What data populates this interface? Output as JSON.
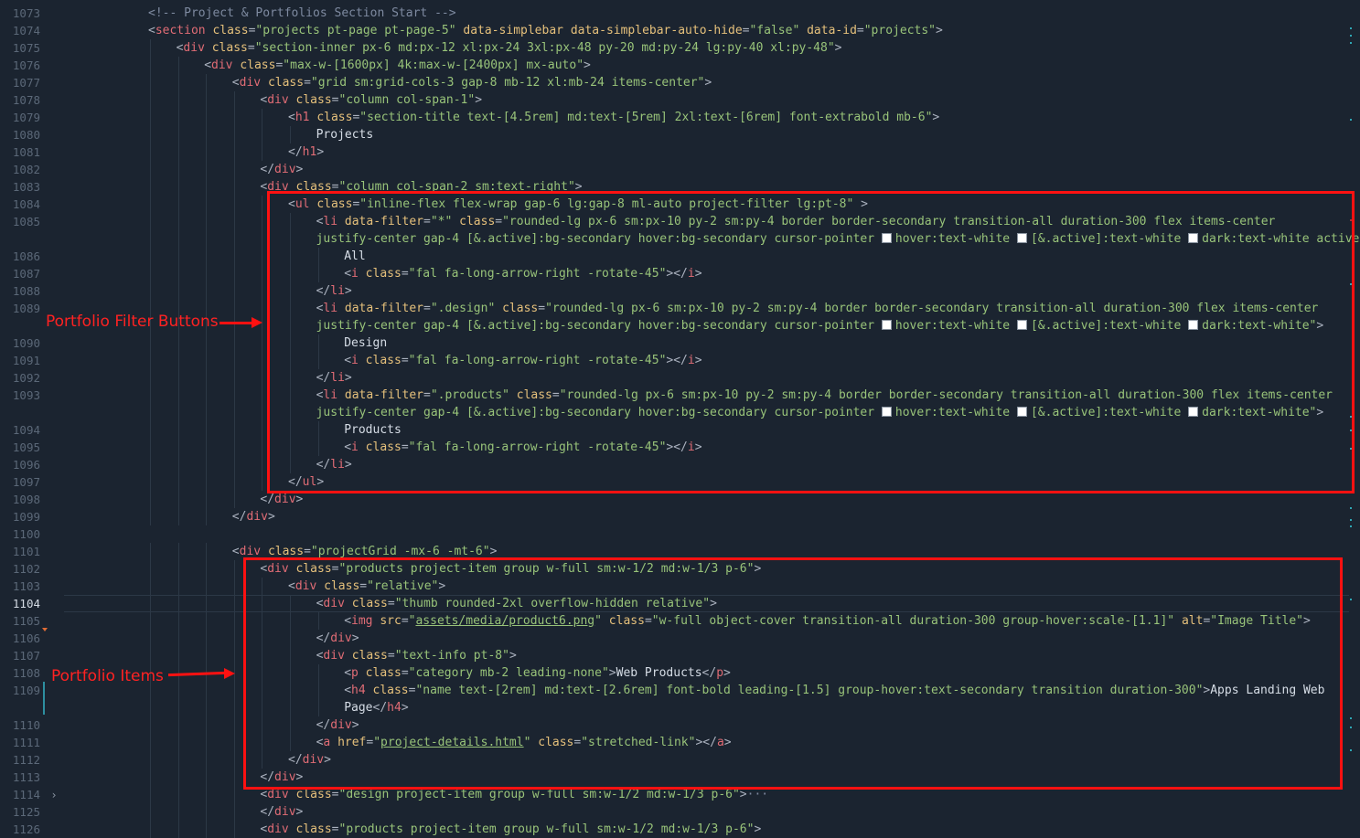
{
  "editor": {
    "current_line": "1104",
    "lines": [
      {
        "no": "1073",
        "indent": 0,
        "html": "<span class=\"comment\">&lt;!-- Project &amp; Portfolios Section Start --&gt;</span>"
      },
      {
        "no": "1074",
        "indent": 0,
        "html": "<span class=\"punct\">&lt;</span><span class=\"tag\">section</span> <span class=\"attr\">class</span><span class=\"punct\">=</span><span class=\"val\">\"projects pt-page pt-page-5\"</span> <span class=\"attr\">data-simplebar</span> <span class=\"attr\">data-simplebar-auto-hide</span><span class=\"punct\">=</span><span class=\"val\">\"false\"</span> <span class=\"attr\">data-id</span><span class=\"punct\">=</span><span class=\"val\">\"projects\"</span><span class=\"punct\">&gt;</span>"
      },
      {
        "no": "1075",
        "indent": 1,
        "html": "<span class=\"punct\">&lt;</span><span class=\"tag\">div</span> <span class=\"attr\">class</span><span class=\"punct\">=</span><span class=\"val\">\"section-inner px-6 md:px-12 xl:px-24 3xl:px-48 py-20 md:py-24 lg:py-40 xl:py-48\"</span><span class=\"punct\">&gt;</span>"
      },
      {
        "no": "1076",
        "indent": 2,
        "html": "<span class=\"punct\">&lt;</span><span class=\"tag\">div</span> <span class=\"attr\">class</span><span class=\"punct\">=</span><span class=\"val\">\"max-w-[1600px] 4k:max-w-[2400px] mx-auto\"</span><span class=\"punct\">&gt;</span>"
      },
      {
        "no": "1077",
        "indent": 3,
        "html": "<span class=\"punct\">&lt;</span><span class=\"tag\">div</span> <span class=\"attr\">class</span><span class=\"punct\">=</span><span class=\"val\">\"grid sm:grid-cols-3 gap-8 mb-12 xl:mb-24 items-center\"</span><span class=\"punct\">&gt;</span>"
      },
      {
        "no": "1078",
        "indent": 4,
        "html": "<span class=\"punct\">&lt;</span><span class=\"tag\">div</span> <span class=\"attr\">class</span><span class=\"punct\">=</span><span class=\"val\">\"column col-span-1\"</span><span class=\"punct\">&gt;</span>"
      },
      {
        "no": "1079",
        "indent": 5,
        "html": "<span class=\"punct\">&lt;</span><span class=\"tag\">h1</span> <span class=\"attr\">class</span><span class=\"punct\">=</span><span class=\"val\">\"section-title text-[4.5rem] md:text-[5rem] 2xl:text-[6rem] font-extrabold mb-6\"</span><span class=\"punct\">&gt;</span>"
      },
      {
        "no": "1080",
        "indent": 6,
        "html": "<span class=\"txt\">Projects</span>"
      },
      {
        "no": "1081",
        "indent": 5,
        "html": "<span class=\"punct\">&lt;/</span><span class=\"tag\">h1</span><span class=\"punct\">&gt;</span>"
      },
      {
        "no": "1082",
        "indent": 4,
        "html": "<span class=\"punct\">&lt;/</span><span class=\"tag\">div</span><span class=\"punct\">&gt;</span>"
      },
      {
        "no": "1083",
        "indent": 4,
        "html": "<span class=\"punct\">&lt;</span><span class=\"tag\">div</span> <span class=\"attr\">class</span><span class=\"punct\">=</span><span class=\"val\">\"column col-span-2 sm:text-right\"</span><span class=\"punct\">&gt;</span>"
      },
      {
        "no": "1084",
        "indent": 5,
        "html": "<span class=\"punct\">&lt;</span><span class=\"tag\">ul</span> <span class=\"attr\">class</span><span class=\"punct\">=</span><span class=\"val\">\"inline-flex flex-wrap gap-6 lg:gap-8 ml-auto project-filter lg:pt-8\"</span> <span class=\"punct\">&gt;</span>"
      },
      {
        "no": "1085",
        "indent": 6,
        "html": "<span class=\"punct\">&lt;</span><span class=\"tag\">li</span> <span class=\"attr\">data-filter</span><span class=\"punct\">=</span><span class=\"val\">\"*\"</span> <span class=\"attr\">class</span><span class=\"punct\">=</span><span class=\"val\">\"rounded-lg px-6 sm:px-10 py-2 sm:py-4 border border-secondary transition-all duration-300 flex items-center</span>"
      },
      {
        "no": "",
        "indent": 6,
        "html": "<span class=\"val\">justify-center gap-4 [&amp;.active]:bg-secondary hover:bg-secondary cursor-pointer <span class=\"swatch\"></span>hover:text-white <span class=\"swatch\"></span>[&amp;.active]:text-white <span class=\"swatch\"></span>dark:text-white active</span>"
      },
      {
        "no": "1086",
        "indent": 7,
        "html": "<span class=\"txt\">All</span>"
      },
      {
        "no": "1087",
        "indent": 7,
        "html": "<span class=\"punct\">&lt;</span><span class=\"tag\">i</span> <span class=\"attr\">class</span><span class=\"punct\">=</span><span class=\"val\">\"fal fa-long-arrow-right -rotate-45\"</span><span class=\"punct\">&gt;&lt;/</span><span class=\"tag\">i</span><span class=\"punct\">&gt;</span>"
      },
      {
        "no": "1088",
        "indent": 6,
        "html": "<span class=\"punct\">&lt;/</span><span class=\"tag\">li</span><span class=\"punct\">&gt;</span>"
      },
      {
        "no": "1089",
        "indent": 6,
        "html": "<span class=\"punct\">&lt;</span><span class=\"tag\">li</span> <span class=\"attr\">data-filter</span><span class=\"punct\">=</span><span class=\"val\">\".design\"</span> <span class=\"attr\">class</span><span class=\"punct\">=</span><span class=\"val\">\"rounded-lg px-6 sm:px-10 py-2 sm:py-4 border border-secondary transition-all duration-300 flex items-center</span>"
      },
      {
        "no": "",
        "indent": 6,
        "html": "<span class=\"val\">justify-center gap-4 [&amp;.active]:bg-secondary hover:bg-secondary cursor-pointer <span class=\"swatch\"></span>hover:text-white <span class=\"swatch\"></span>[&amp;.active]:text-white <span class=\"swatch\"></span>dark:text-white\"</span><span class=\"punct\">&gt;</span>"
      },
      {
        "no": "1090",
        "indent": 7,
        "html": "<span class=\"txt\">Design</span>"
      },
      {
        "no": "1091",
        "indent": 7,
        "html": "<span class=\"punct\">&lt;</span><span class=\"tag\">i</span> <span class=\"attr\">class</span><span class=\"punct\">=</span><span class=\"val\">\"fal fa-long-arrow-right -rotate-45\"</span><span class=\"punct\">&gt;&lt;/</span><span class=\"tag\">i</span><span class=\"punct\">&gt;</span>"
      },
      {
        "no": "1092",
        "indent": 6,
        "html": "<span class=\"punct\">&lt;/</span><span class=\"tag\">li</span><span class=\"punct\">&gt;</span>"
      },
      {
        "no": "1093",
        "indent": 6,
        "html": "<span class=\"punct\">&lt;</span><span class=\"tag\">li</span> <span class=\"attr\">data-filter</span><span class=\"punct\">=</span><span class=\"val\">\".products\"</span> <span class=\"attr\">class</span><span class=\"punct\">=</span><span class=\"val\">\"rounded-lg px-6 sm:px-10 py-2 sm:py-4 border border-secondary transition-all duration-300 flex items-center</span>"
      },
      {
        "no": "",
        "indent": 6,
        "html": "<span class=\"val\">justify-center gap-4 [&amp;.active]:bg-secondary hover:bg-secondary cursor-pointer <span class=\"swatch\"></span>hover:text-white <span class=\"swatch\"></span>[&amp;.active]:text-white <span class=\"swatch\"></span>dark:text-white\"</span><span class=\"punct\">&gt;</span>"
      },
      {
        "no": "1094",
        "indent": 7,
        "html": "<span class=\"txt\">Products</span>"
      },
      {
        "no": "1095",
        "indent": 7,
        "html": "<span class=\"punct\">&lt;</span><span class=\"tag\">i</span> <span class=\"attr\">class</span><span class=\"punct\">=</span><span class=\"val\">\"fal fa-long-arrow-right -rotate-45\"</span><span class=\"punct\">&gt;&lt;/</span><span class=\"tag\">i</span><span class=\"punct\">&gt;</span>"
      },
      {
        "no": "1096",
        "indent": 6,
        "html": "<span class=\"punct\">&lt;/</span><span class=\"tag\">li</span><span class=\"punct\">&gt;</span>"
      },
      {
        "no": "1097",
        "indent": 5,
        "html": "<span class=\"punct\">&lt;/</span><span class=\"tag\">ul</span><span class=\"punct\">&gt;</span>"
      },
      {
        "no": "1098",
        "indent": 4,
        "html": "<span class=\"punct\">&lt;/</span><span class=\"tag\">div</span><span class=\"punct\">&gt;</span>"
      },
      {
        "no": "1099",
        "indent": 3,
        "html": "<span class=\"punct\">&lt;/</span><span class=\"tag\">div</span><span class=\"punct\">&gt;</span>"
      },
      {
        "no": "1100",
        "indent": 0,
        "html": ""
      },
      {
        "no": "1101",
        "indent": 3,
        "html": "<span class=\"punct\">&lt;</span><span class=\"tag\">div</span> <span class=\"attr\">class</span><span class=\"punct\">=</span><span class=\"val\">\"projectGrid -mx-6 -mt-6\"</span><span class=\"punct\">&gt;</span>"
      },
      {
        "no": "1102",
        "indent": 4,
        "html": "<span class=\"punct\">&lt;</span><span class=\"tag\">div</span> <span class=\"attr\">class</span><span class=\"punct\">=</span><span class=\"val\">\"products project-item group w-full sm:w-1/2 md:w-1/3 p-6\"</span><span class=\"punct\">&gt;</span>"
      },
      {
        "no": "1103",
        "indent": 5,
        "html": "<span class=\"punct\">&lt;</span><span class=\"tag\">div</span> <span class=\"attr\">class</span><span class=\"punct\">=</span><span class=\"val\">\"relative\"</span><span class=\"punct\">&gt;</span>"
      },
      {
        "no": "1104",
        "indent": 6,
        "html": "<span class=\"punct\">&lt;</span><span class=\"tag\">div</span> <span class=\"attr\">class</span><span class=\"punct\">=</span><span class=\"val\">\"thumb rounded-2xl overflow-hidden relative\"</span><span class=\"punct\">&gt;</span>"
      },
      {
        "no": "1105",
        "indent": 7,
        "html": "<span class=\"punct\">&lt;</span><span class=\"tag\">img</span> <span class=\"attr\">src</span><span class=\"punct\">=</span><span class=\"val\">\"<span class=\"link\">assets/media/product6.png</span>\"</span> <span class=\"attr\">class</span><span class=\"punct\">=</span><span class=\"val\">\"w-full object-cover transition-all duration-300 group-hover:scale-[1.1]\"</span> <span class=\"attr\">alt</span><span class=\"punct\">=</span><span class=\"val\">\"Image Title\"</span><span class=\"punct\">&gt;</span>"
      },
      {
        "no": "1106",
        "indent": 6,
        "html": "<span class=\"punct\">&lt;/</span><span class=\"tag\">div</span><span class=\"punct\">&gt;</span>"
      },
      {
        "no": "1107",
        "indent": 6,
        "html": "<span class=\"punct\">&lt;</span><span class=\"tag\">div</span> <span class=\"attr\">class</span><span class=\"punct\">=</span><span class=\"val\">\"text-info pt-8\"</span><span class=\"punct\">&gt;</span>"
      },
      {
        "no": "1108",
        "indent": 7,
        "html": "<span class=\"punct\">&lt;</span><span class=\"tag\">p</span> <span class=\"attr\">class</span><span class=\"punct\">=</span><span class=\"val\">\"category mb-2 leading-none\"</span><span class=\"punct\">&gt;</span><span class=\"txt\">Web Products</span><span class=\"punct\">&lt;/</span><span class=\"tag\">p</span><span class=\"punct\">&gt;</span>"
      },
      {
        "no": "1109",
        "indent": 7,
        "html": "<span class=\"punct\">&lt;</span><span class=\"tag\">h4</span> <span class=\"attr\">class</span><span class=\"punct\">=</span><span class=\"val\">\"name text-[2rem] md:text-[2.6rem] font-bold leading-[1.5] group-hover:text-secondary transition duration-300\"</span><span class=\"punct\">&gt;</span><span class=\"txt\">Apps Landing Web</span>"
      },
      {
        "no": "",
        "indent": 7,
        "html": "<span class=\"txt\">Page</span><span class=\"punct\">&lt;/</span><span class=\"tag\">h4</span><span class=\"punct\">&gt;</span>"
      },
      {
        "no": "1110",
        "indent": 6,
        "html": "<span class=\"punct\">&lt;/</span><span class=\"tag\">div</span><span class=\"punct\">&gt;</span>"
      },
      {
        "no": "1111",
        "indent": 6,
        "html": "<span class=\"punct\">&lt;</span><span class=\"tag\">a</span> <span class=\"attr\">href</span><span class=\"punct\">=</span><span class=\"val\">\"<span class=\"link\">project-details.html</span>\"</span> <span class=\"attr\">class</span><span class=\"punct\">=</span><span class=\"val\">\"stretched-link\"</span><span class=\"punct\">&gt;&lt;/</span><span class=\"tag\">a</span><span class=\"punct\">&gt;</span>"
      },
      {
        "no": "1112",
        "indent": 5,
        "html": "<span class=\"punct\">&lt;/</span><span class=\"tag\">div</span><span class=\"punct\">&gt;</span>"
      },
      {
        "no": "1113",
        "indent": 4,
        "html": "<span class=\"punct\">&lt;/</span><span class=\"tag\">div</span><span class=\"punct\">&gt;</span>"
      },
      {
        "no": "1114",
        "indent": 4,
        "html": "<span class=\"punct\">&lt;</span><span class=\"tag\">div</span> <span class=\"attr\">class</span><span class=\"punct\">=</span><span class=\"val\">\"design project-item group w-full sm:w-1/2 md:w-1/3 p-6\"</span><span class=\"punct\">&gt;</span><span class=\"ellipsis\">···</span>"
      },
      {
        "no": "1125",
        "indent": 4,
        "html": "<span class=\"punct\">&lt;/</span><span class=\"tag\">div</span><span class=\"punct\">&gt;</span>"
      },
      {
        "no": "1126",
        "indent": 4,
        "html": "<span class=\"punct\">&lt;</span><span class=\"tag\">div</span> <span class=\"attr\">class</span><span class=\"punct\">=</span><span class=\"val\">\"products project-item group w-full sm:w-1/2 md:w-1/3 p-6\"</span><span class=\"punct\">&gt;</span>"
      }
    ]
  },
  "annotations": {
    "filter_label": "Portfolio Filter Buttons",
    "items_label": "Portfolio Items",
    "color": "#ff1111"
  },
  "icons": {
    "fold_open": "chevron-right-icon",
    "folded_region_marker": "fold-marker-icon"
  }
}
